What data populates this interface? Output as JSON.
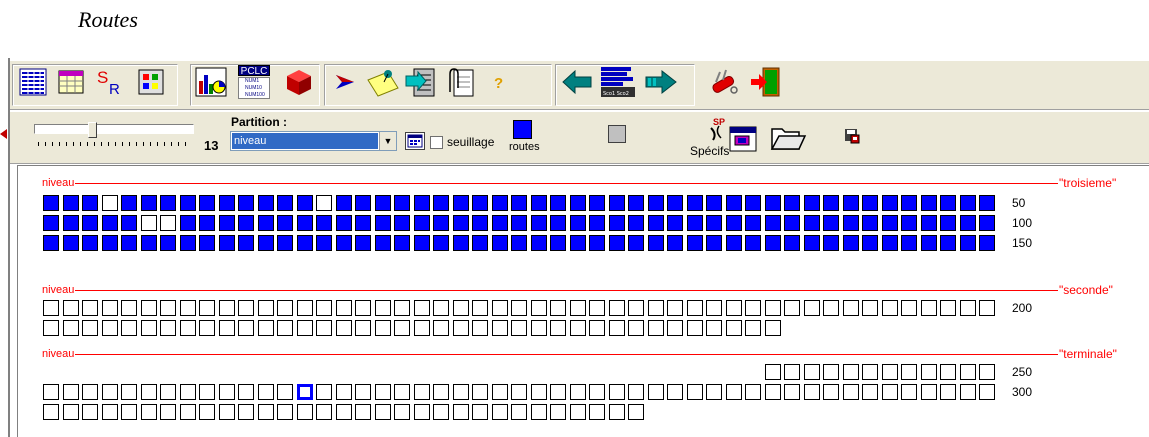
{
  "doc_title": "Routes",
  "toolbar": {
    "pclc_label": "PCLC",
    "pclc_lines": [
      "NUM1",
      "NUM10",
      "NUM100"
    ],
    "grades_label": "Sco1 Sco2"
  },
  "controls": {
    "slider_value": "13",
    "partition_label": "Partition :",
    "partition_value": "niveau",
    "seuillage_label": "seuillage",
    "seuillage_checked": false,
    "routes_label": "routes",
    "specifs_label": "Spécifs",
    "specifs_icon_text": "SP"
  },
  "colors": {
    "filled": "#0000ff",
    "empty": "#ffffff",
    "section_line": "#ff0000"
  },
  "sections": [
    {
      "label": "niveau",
      "name": "\"troisieme\"",
      "rows": [
        {
          "number": "50",
          "pattern": "FFFEFFFFFFFFFFEFFFFFFFFFFFFFFFFFFFFFFFFFFFFFFFFFF"
        },
        {
          "number": "100",
          "pattern": "FFFFFEEFFFFFFFFFFFFFFFFFFFFFFFFFFFFFFFFFFFFFFFFFF"
        },
        {
          "number": "150",
          "pattern": "FFFFFFFFFFFFFFFFFFFFFFFFFFFFFFFFFFFFFFFFFFFFFFFFF"
        }
      ]
    },
    {
      "label": "niveau",
      "name": "\"seconde\"",
      "rows": [
        {
          "number": "200",
          "pattern": "EEEEEEEEEEEEEEEEEEEEEEEEEEEEEEEEEEEEEEEEEEEEEEEEE"
        },
        {
          "number": "",
          "pattern": "EEEEEEEEEEEEEEEEEEEEEEEEEEEEEEEEEEEEEE"
        }
      ]
    },
    {
      "label": "niveau",
      "name": "\"terminale\"",
      "rows": [
        {
          "number": "250",
          "offset": 37,
          "pattern": "EEEEEEEEEEEE"
        },
        {
          "number": "300",
          "pattern": "EEEEEEEEEEEEESEEEEEEEEEEEEEEEEEEEEEEEEEEEEEEEEEEE"
        },
        {
          "number": "",
          "pattern": "EEEEEEEEEEEEEEEEEEEEEEEEEEEEEEE"
        }
      ]
    }
  ]
}
